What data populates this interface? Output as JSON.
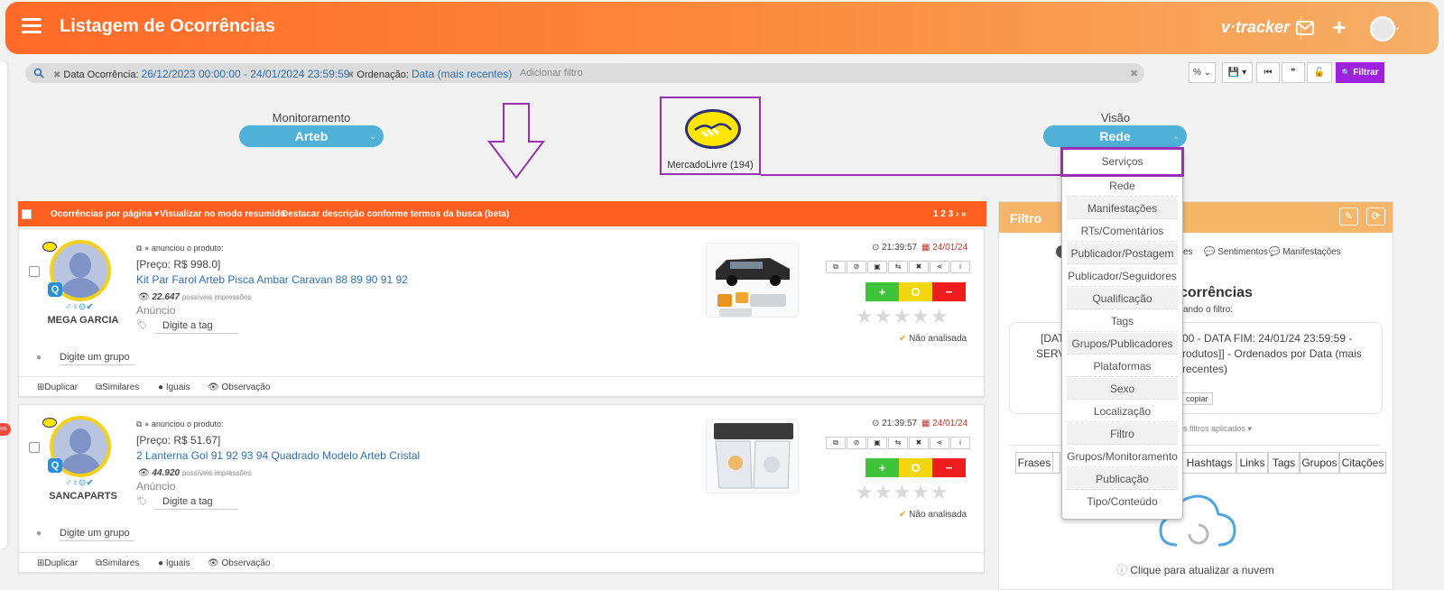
{
  "header": {
    "title": "Listagem de Ocorrências",
    "brand": "v·tracker",
    "plus": "+",
    "avatar_caret": "⌄"
  },
  "filterbar": {
    "search_icon": "search-icon",
    "date_label": "Data Ocorrência:",
    "date_value": "26/12/2023 00:00:00 - 24/01/2024 23:59:59",
    "order_label": "Ordenação:",
    "order_value": "Data (mais recentes)",
    "add_filter": "Adicionar filtro",
    "clear": "✖"
  },
  "toolbar": {
    "percent": "% ⌄",
    "save": "💾 ▾",
    "first": "⏮",
    "quote": "❞",
    "unlock": "🔓",
    "filter_button": "Filtrar",
    "filter_icon": "🔍"
  },
  "monitoramento": {
    "label": "Monitoramento",
    "value": "Arteb"
  },
  "visao": {
    "label": "Visão",
    "value": "Rede"
  },
  "source": {
    "name": "MercadoLivre (194)"
  },
  "visao_dropdown": {
    "options": [
      "Serviços",
      "Rede",
      "Manifestações",
      "RTs/Comentários",
      "Publicador/Postagem",
      "Publicador/Seguidores",
      "Qualificação",
      "Tags",
      "Grupos/Publicadores",
      "Plataformas",
      "Sexo",
      "Localização",
      "Filtro",
      "Grupos/Monitoramento",
      "Publicação",
      "Tipo/Conteúdo"
    ],
    "highlighted": "Serviços"
  },
  "listhead": {
    "per_page": "Ocorrências por página ▾",
    "summary_mode": "Visualizar no modo resumido",
    "highlight_desc": "Destacar descrição conforme termos da busca (beta)",
    "pages": "1 2 3 › »"
  },
  "occurrences": [
    {
      "user": "MEGA GARCIA",
      "announce": "anunciou o produto:",
      "price": "[Preço: R$ 998.0]",
      "title": "Kit Par Farol Arteb Pisca Ambar Caravan 88 89 90 91 92",
      "impressions": "22.647",
      "impressions_label": "possíveis impressões",
      "type": "Anúncio",
      "tag_placeholder": "Digite a tag",
      "group_placeholder": "Digite um grupo",
      "time": "21:39:57",
      "date": "24/01/24",
      "status": "Não analisada",
      "symbols": "♂♀⊝✔"
    },
    {
      "user": "SANCAPARTS",
      "announce": "anunciou o produto:",
      "price": "[Preço: R$ 51.67]",
      "title": "2 Lanterna Gol 91 92 93 94 Quadrado Modelo Arteb Cristal",
      "impressions": "44.920",
      "impressions_label": "possíveis impressões",
      "type": "Anúncio",
      "tag_placeholder": "Digite a tag",
      "group_placeholder": "Digite um grupo",
      "time": "21:39:57",
      "date": "24/01/24",
      "status": "Não analisada",
      "symbols": "♂♀⊝✔"
    }
  ],
  "card_actions": {
    "duplicate": "Duplicar",
    "similar": "Similares",
    "equal": "Iguais",
    "observation": "Observação"
  },
  "card_buttons": {
    "plus": "+",
    "neutral": "O",
    "minus": "−",
    "stars": "★★★★★",
    "check": "✔"
  },
  "filter_panel": {
    "title": "Filtro",
    "tab_partial_1": "es",
    "tab_sentiments": "Sentimentos",
    "tab_manifestations": "Manifestações",
    "heading_partial": "corrências",
    "subtitle_partial": "ando o filtro:",
    "desc_line1_a": "[DAT",
    "desc_line1_b": "00 - DATA FIM: 24/01/24 23:59:59 -",
    "desc_line2_a": "SERV",
    "desc_line2_b": "rodutos]] - Ordenados por Data (mais",
    "desc_line3": "recentes)",
    "copy": "copiar",
    "applied": "s filtros aplicados ▾",
    "tabs": [
      "Frases",
      "Hashtags",
      "Links",
      "Tags",
      "Grupos",
      "Citações"
    ],
    "refresh_hint": "Clique para atualizar a nuvem"
  },
  "side_badge": "vo",
  "colors": {
    "header_start": "#ff6a28",
    "header_end": "#f6b068",
    "accent": "#9b30b5",
    "select": "#4fb0d8",
    "list_head": "#ff5f1f"
  }
}
